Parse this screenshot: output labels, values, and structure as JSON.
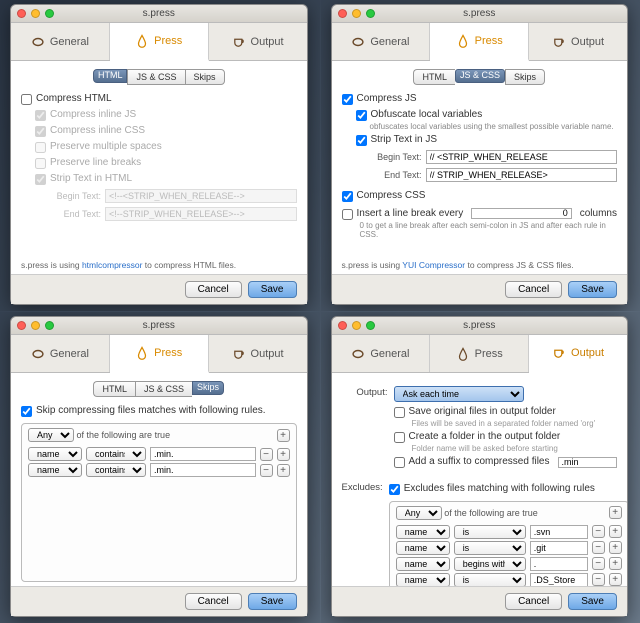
{
  "app_title": "s.press",
  "tabs": {
    "general": "General",
    "press": "Press",
    "output": "Output"
  },
  "segments": {
    "html": "HTML",
    "jscss": "JS & CSS",
    "skips": "Skips"
  },
  "buttons": {
    "cancel": "Cancel",
    "save": "Save"
  },
  "panel_html": {
    "compress_html": "Compress HTML",
    "inline_js": "Compress inline JS",
    "inline_css": "Compress inline CSS",
    "preserve_spaces": "Preserve multiple spaces",
    "preserve_breaks": "Preserve line breaks",
    "strip_text": "Strip Text in HTML",
    "begin_label": "Begin Text:",
    "end_label": "End Text:",
    "begin_val": "<!--<STRIP_WHEN_RELEASE-->",
    "end_val": "<!--STRIP_WHEN_RELEASE>-->",
    "info_pre": "s.press is using ",
    "info_link": "htmlcompressor",
    "info_post": " to compress HTML files."
  },
  "panel_js": {
    "compress_js": "Compress JS",
    "obfuscate": "Obfuscate local variables",
    "obfuscate_note": "obfuscates local variables using the smallest possible variable name.",
    "strip_text": "Strip Text in JS",
    "begin_label": "Begin Text:",
    "end_label": "End Text:",
    "begin_val": "// <STRIP_WHEN_RELEASE",
    "end_val": "// STRIP_WHEN_RELEASE>",
    "compress_css": "Compress CSS",
    "linebreak_pre": "Insert a line break every",
    "linebreak_val": "0",
    "linebreak_post": "columns",
    "linebreak_note": "0 to get a line break after each semi-colon in JS and after each rule in CSS.",
    "info_pre": "s.press is using ",
    "info_link": "YUI Compressor",
    "info_post": " to compress JS & CSS files."
  },
  "panel_skips": {
    "skip_label": "Skip compressing files matches with following rules.",
    "any_label": "Any",
    "of_label": "of the following are true",
    "rows": [
      {
        "field": "name",
        "op": "contains",
        "val": ".min."
      },
      {
        "field": "name",
        "op": "contains",
        "val": ".min."
      }
    ]
  },
  "panel_output": {
    "output_label": "Output:",
    "output_select": "Ask each time",
    "save_orig": "Save original files in output folder",
    "save_orig_note": "Files will be saved in a separated folder named 'org'",
    "create_folder": "Create a folder in the output folder",
    "create_folder_note": "Folder name will be asked before starting",
    "add_suffix": "Add a suffix to compressed files",
    "suffix_val": ".min",
    "excludes_label": "Excludes:",
    "excludes_chk": "Excludes files matching with following rules",
    "any_label": "Any",
    "of_label": "of the following are true",
    "rows": [
      {
        "field": "name",
        "op": "is",
        "val": ".svn"
      },
      {
        "field": "name",
        "op": "is",
        "val": ".git"
      },
      {
        "field": "name",
        "op": "begins with",
        "val": "."
      },
      {
        "field": "name",
        "op": "is",
        "val": ".DS_Store"
      }
    ]
  }
}
